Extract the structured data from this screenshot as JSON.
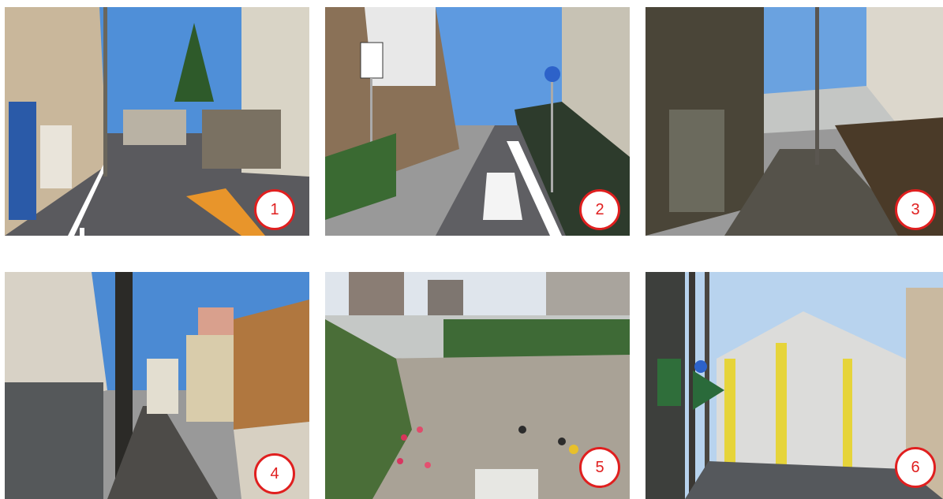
{
  "photos": [
    {
      "number": "1"
    },
    {
      "number": "2"
    },
    {
      "number": "3"
    },
    {
      "number": "4"
    },
    {
      "number": "5"
    },
    {
      "number": "6"
    }
  ],
  "colors": {
    "badge_border": "#e01f1f",
    "badge_text": "#e01f1f",
    "background": "#ffffff"
  }
}
